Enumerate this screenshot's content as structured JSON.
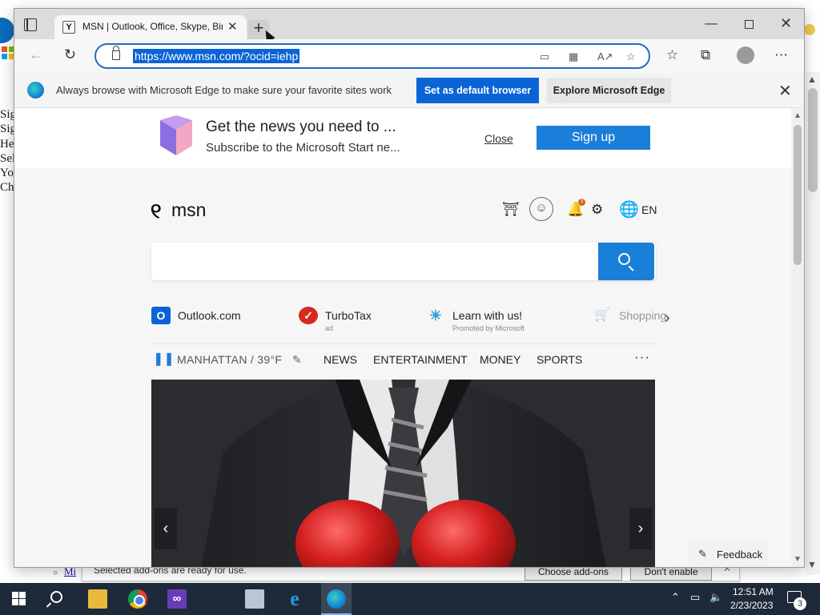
{
  "background": {
    "side_text": [
      "Sig",
      "Sig",
      "He",
      "Sel",
      "Yo",
      "Ch"
    ],
    "link_text": "Mi",
    "notification": {
      "text": "Selected add-ons are ready for use.",
      "choose_label": "Choose add-ons",
      "dont_enable_label": "Don't enable"
    }
  },
  "browser": {
    "tab": {
      "title": "MSN | Outlook, Office, Skype, Bing",
      "favicon": "Y"
    },
    "new_tab_label": "+",
    "address": {
      "url": "https://www.msn.com/?ocid=iehp"
    },
    "infobar": {
      "text": "Always browse with Microsoft Edge to make sure your favorite sites work",
      "set_default_label": "Set as default browser",
      "explore_label": "Explore Microsoft Edge"
    }
  },
  "page": {
    "promo": {
      "title": "Get the news you need to ...",
      "subtitle": "Subscribe to the Microsoft Start ne...",
      "close_label": "Close",
      "signup_label": "Sign up"
    },
    "header": {
      "logo_mark": "୧",
      "logo_text": "msn",
      "notification_count": "3",
      "language": "EN"
    },
    "quicklinks": [
      {
        "label": "Outlook.com",
        "sub": "",
        "icon": "O",
        "color": "#0a64d6"
      },
      {
        "label": "TurboTax",
        "sub": "ad",
        "icon": "✓",
        "color": "#d52b1e"
      },
      {
        "label": "Learn with us!",
        "sub": "Promoted by Microsoft",
        "icon": "☀",
        "color": "#2aa0d8"
      },
      {
        "label": "Shopping",
        "sub": "",
        "icon": "🛒",
        "color": "#3e8fe0"
      }
    ],
    "weather": {
      "location": "MANHATTAN / 39°F"
    },
    "nav": [
      "NEWS",
      "ENTERTAINMENT",
      "MONEY",
      "SPORTS"
    ],
    "feedback_label": "Feedback"
  },
  "taskbar": {
    "time": "12:51 AM",
    "date": "2/23/2023",
    "action_center_count": "3"
  },
  "colors": {
    "accent": "#0a64d6",
    "msn_blue": "#1a7fd8",
    "taskbar": "#1e2a3a"
  }
}
